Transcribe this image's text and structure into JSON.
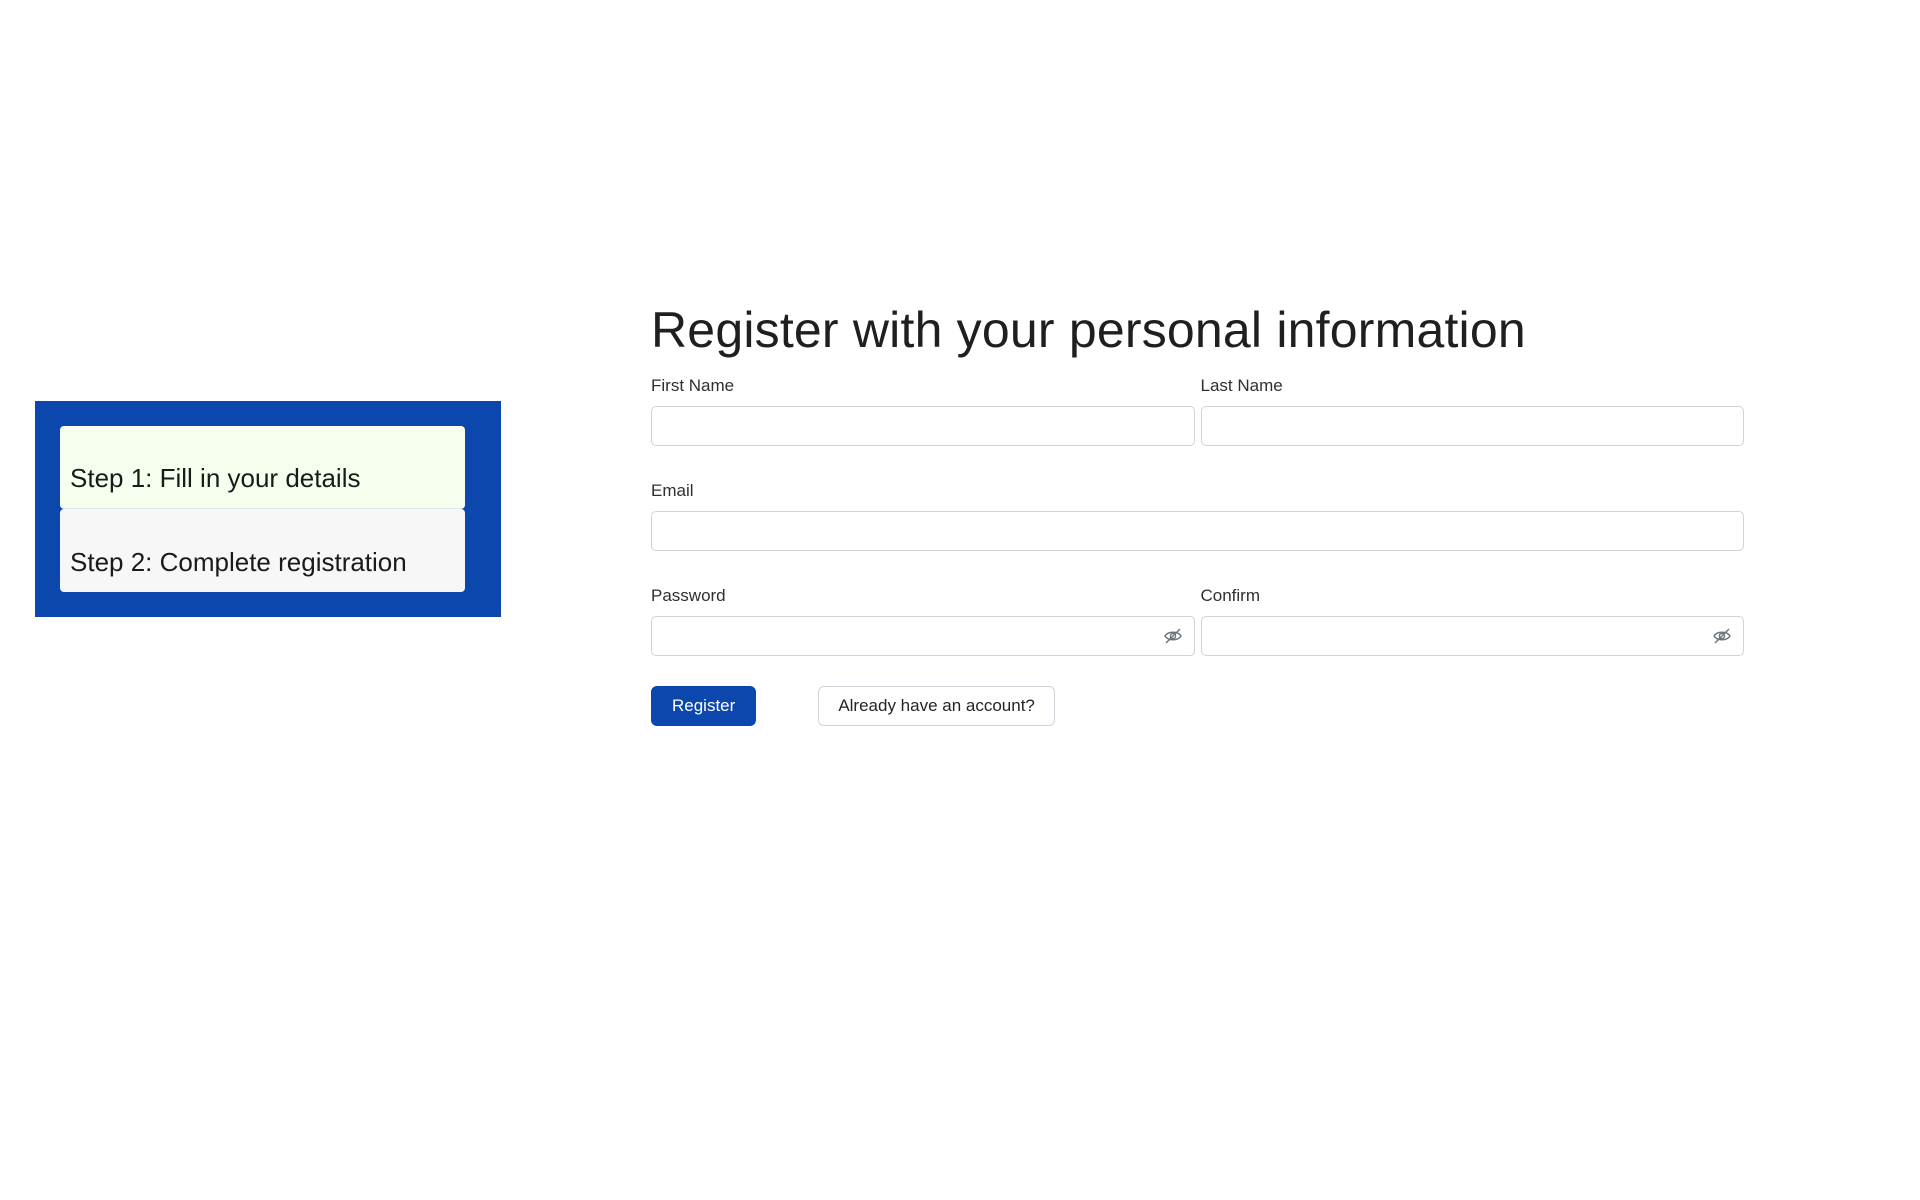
{
  "steps": [
    {
      "label": "Step 1: Fill in your details",
      "state": "active"
    },
    {
      "label": "Step 2: Complete registration",
      "state": "inactive"
    }
  ],
  "form": {
    "title": "Register with your personal information",
    "first_name": {
      "label": "First Name",
      "value": "",
      "placeholder": ""
    },
    "last_name": {
      "label": "Last Name",
      "value": "",
      "placeholder": ""
    },
    "email": {
      "label": "Email",
      "value": "",
      "placeholder": ""
    },
    "password": {
      "label": "Password",
      "value": "",
      "placeholder": "",
      "toggle_icon": "eye-slash-icon"
    },
    "confirm": {
      "label": "Confirm",
      "value": "",
      "placeholder": "",
      "toggle_icon": "eye-slash-icon"
    },
    "register_label": "Register",
    "login_label": "Already have an account?"
  },
  "colors": {
    "accent": "#0b47ad",
    "active_step_bg": "#f6ffee",
    "inactive_step_bg": "#f7f7f7"
  }
}
